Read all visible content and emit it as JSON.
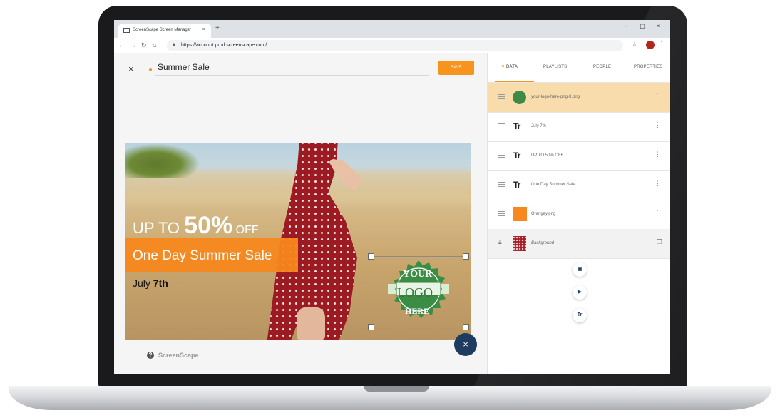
{
  "browser": {
    "tab_title": "ScreenScape Screen Manager",
    "tab_close": "×",
    "new_tab": "+",
    "url": "https://account.prod.screenscape.com/",
    "minimize": "–",
    "maximize": "▢",
    "close": "×"
  },
  "editor": {
    "close_label": "×",
    "title": "Summer Sale",
    "save_label": "SAVE",
    "help_label": "?",
    "brand": "ScreenScape"
  },
  "canvas": {
    "promo_prefix": "UP TO ",
    "promo_percent": "50%",
    "promo_suffix": " OFF",
    "sale_text": "One Day Summer Sale",
    "date_prefix": "July ",
    "date_day": "7th",
    "logo_top": "YOUR",
    "logo_mid": "LOGO",
    "logo_bot": "HERE"
  },
  "panel": {
    "tabs": [
      {
        "label": "DATA"
      },
      {
        "label": "PLAYLISTS"
      },
      {
        "label": "PEOPLE"
      },
      {
        "label": "PROPERTIES"
      }
    ],
    "layers": [
      {
        "name": "your-logo-here-png-3.png",
        "kind": "image"
      },
      {
        "name": "July 7th",
        "kind": "text"
      },
      {
        "name": "UP TO 50% OFF",
        "kind": "text"
      },
      {
        "name": "One Day Summer Sale",
        "kind": "text"
      },
      {
        "name": "Orangey.png",
        "kind": "image"
      },
      {
        "name": "Background",
        "kind": "background"
      }
    ],
    "text_glyph": "Tr"
  },
  "fab": {
    "image_icon": "image-icon",
    "video_icon": "video-icon",
    "text_label": "Tr",
    "close_label": "×"
  },
  "colors": {
    "accent": "#f7941d",
    "fab": "#1f3b5f",
    "selected_layer": "#f9dcab"
  }
}
